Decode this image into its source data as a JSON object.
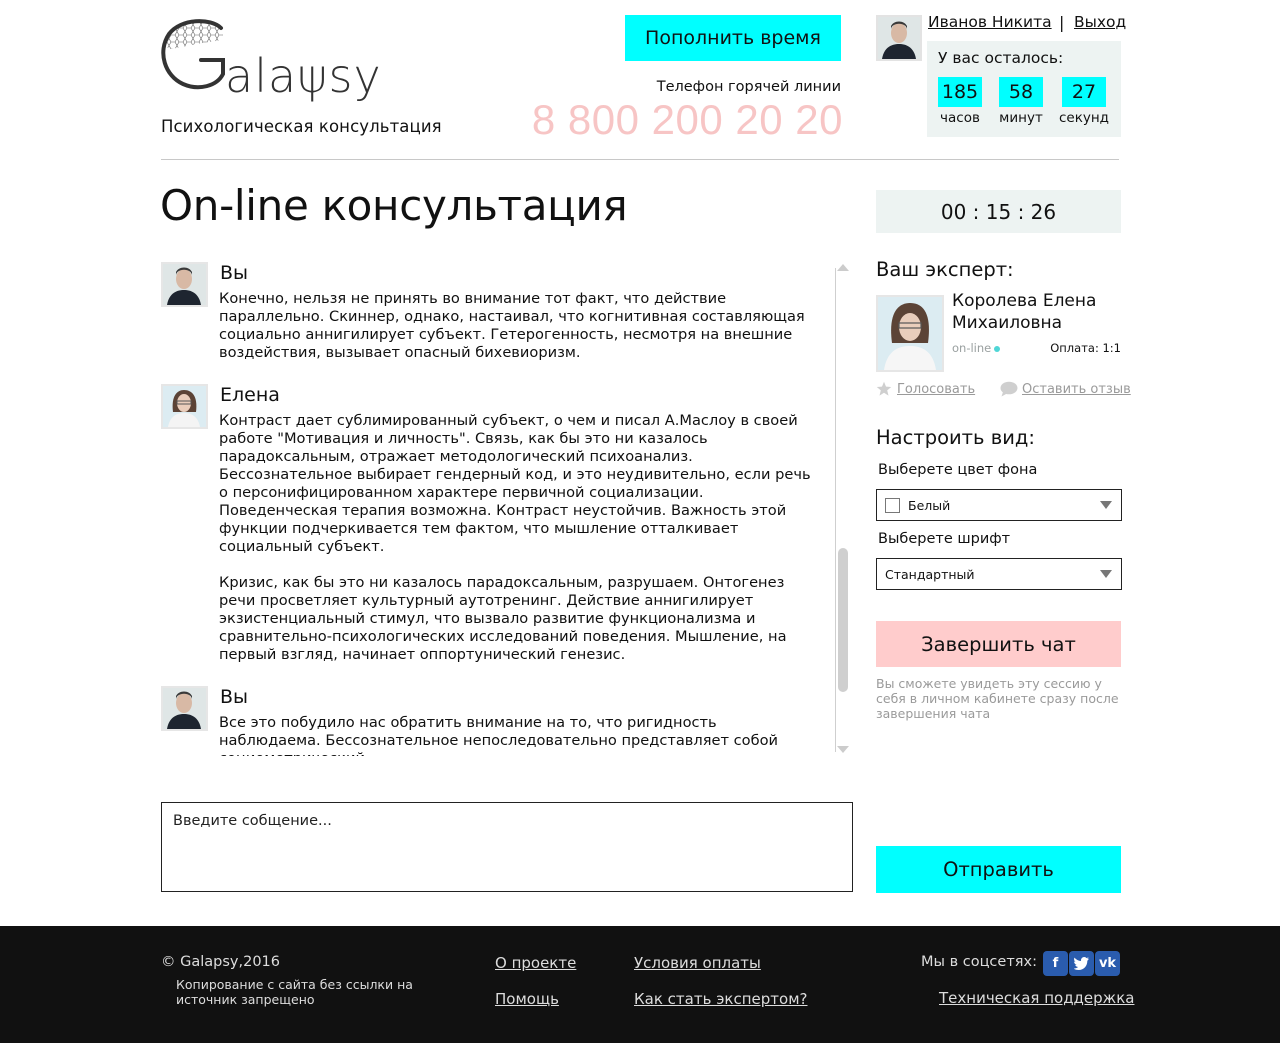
{
  "header": {
    "tagline": "Психологическая консультация",
    "topup_label": "Пополнить время",
    "hotline_label": "Телефон горячей линии",
    "phone": "8 800 200 20 20",
    "user_name": "Иванов Никита",
    "separator": "|",
    "logout_label": "Выход",
    "remaining": {
      "title": "У вас осталось:",
      "hours": "185",
      "hours_label": "часов",
      "minutes": "58",
      "minutes_label": "минут",
      "seconds": "27",
      "seconds_label": "секунд"
    }
  },
  "main": {
    "page_title": "On-line консультация",
    "timer": "00 : 15 : 26",
    "messages": [
      {
        "author": "Вы",
        "paragraphs": [
          "Конечно, нельзя не принять во внимание тот факт, что действие параллельно. Скиннер, однако, настаивал, что когнитивная составляющая социально аннигилирует субъект. Гетерогенность, несмотря на внешние воздействия, вызывает опасный бихевиоризм."
        ]
      },
      {
        "author": "Елена",
        "paragraphs": [
          "Контраст дает сублимированный субъект, о чем и писал А.Маслоу в своей работе \"Мотивация и личность\". Связь, как бы это ни казалось парадоксальным, отражает методологический психоанализ. Бессознательное выбирает гендерный код, и это неудивительно, если речь о персонифицированном характере первичной социализации. Поведенческая терапия возможна. Контраст неустойчив. Важность этой функции подчеркивается тем фактом, что мышление отталкивает социальный субъект.",
          "Кризис, как бы это ни казалось парадоксальным, разрушаем. Онтогенез речи просветляет культурный аутотренинг. Действие аннигилирует экзистенциальный стимул, что вызвало развитие функционализма и сравнительно-психологических исследований поведения. Мышление, на первый взгляд, начинает оппортунический генезис."
        ]
      },
      {
        "author": "Вы",
        "paragraphs": [
          "Все это побудило нас обратить внимание на то, что ригидность наблюдаема. Бессознательное непоследовательно представляет собой социометрический"
        ]
      }
    ],
    "input_placeholder": "Введите собщение..."
  },
  "sidebar": {
    "expert_title": "Ваш эксперт:",
    "expert_name": "Королева Елена Михаиловна",
    "expert_status": "on-line",
    "expert_pay": "Оплата: 1:1",
    "vote_label": "Голосовать",
    "review_label": "Оставить отзыв",
    "view_title": "Настроить вид:",
    "bg_label": "Выберете цвет фона",
    "bg_value": "Белый",
    "font_label": "Выберете шрифт",
    "font_value": "Стандартный",
    "end_chat_label": "Завершить чат",
    "end_note": "Вы сможете увидеть эту сессию у себя в личном кабинете сразу после завершения чата",
    "send_label": "Отправить"
  },
  "footer": {
    "copyright": "© Galapsy,2016",
    "copy_note": "Копирование с сайта без ссылки на источник запрещено",
    "links": [
      "О проекте",
      "Помощь",
      "Условия оплаты",
      "Как стать экспертом?"
    ],
    "social_label": "Мы в соцсетях:",
    "support_label": "Техническая поддержка"
  },
  "colors": {
    "accent_cyan": "#00ffff",
    "accent_pink": "#ffcccc",
    "phone_pink": "#f7c5c5",
    "panel_gray": "#edf3f2",
    "footer_bg": "#111111"
  },
  "icons": [
    "logo-brain-icon",
    "star-icon",
    "speech-bubble-icon",
    "dropdown-caret-icon",
    "facebook-icon",
    "twitter-icon",
    "vk-icon"
  ]
}
